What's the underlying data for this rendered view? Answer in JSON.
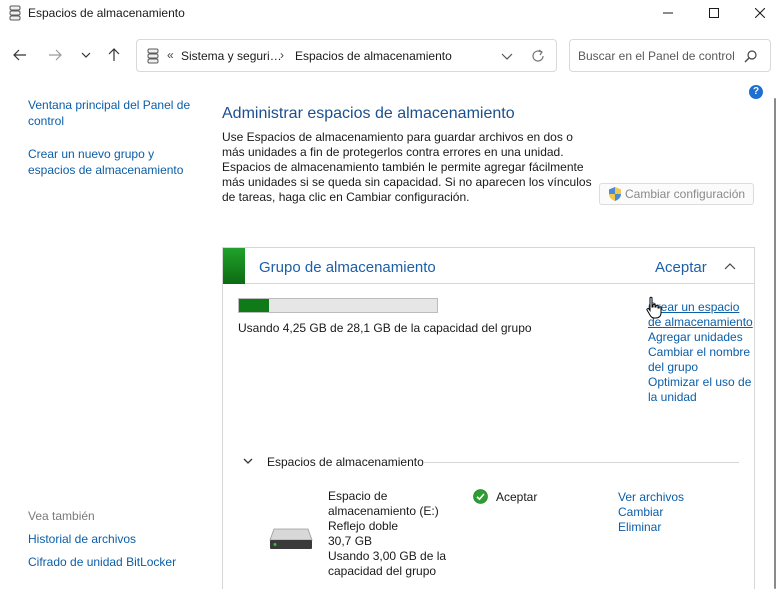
{
  "window": {
    "title": "Espacios de almacenamiento"
  },
  "nav": {
    "breadcrumb_prefix": "«",
    "crumbs": [
      "Sistema y seguri…",
      "Espacios de almacenamiento"
    ],
    "separator": "›",
    "search_placeholder": "Buscar en el Panel de control"
  },
  "sidebar": {
    "links": [
      "Ventana principal del Panel de control",
      "Crear un nuevo grupo y espacios de almacenamiento"
    ],
    "see_also_label": "Vea también",
    "see_also_links": [
      "Historial de archivos",
      "Cifrado de unidad BitLocker"
    ]
  },
  "help": {
    "label": "?"
  },
  "main": {
    "title": "Administrar espacios de almacenamiento",
    "description": "Use Espacios de almacenamiento para guardar archivos en dos o más unidades a fin de protegerlos contra errores en una unidad. Espacios de almacenamiento también le permite agregar fácilmente más unidades si se queda sin capacidad. Si no aparecen los vínculos de tareas, haga clic en Cambiar configuración.",
    "change_settings_label": "Cambiar configuración"
  },
  "pool": {
    "title": "Grupo de almacenamiento",
    "status": "Aceptar",
    "usage_fraction": 0.151,
    "usage_text": "Usando 4,25 GB de 28,1 GB de la capacidad del grupo",
    "links": [
      "Crear un espacio de almacenamiento",
      "Agregar unidades",
      "Cambiar el nombre del grupo",
      "Optimizar el uso de la unidad"
    ],
    "spaces_section_label": "Espacios de almacenamiento",
    "space": {
      "name": "Espacio de almacenamiento (E:)",
      "type": "Reflejo doble",
      "size": "30,7 GB",
      "usage": "Usando 3,00 GB de la capacidad del grupo",
      "status": "Aceptar",
      "links": [
        "Ver archivos",
        "Cambiar",
        "Eliminar"
      ]
    }
  },
  "colors": {
    "link": "#0b5ea8",
    "accent_green": "#0f7a18",
    "heading": "#1c4f8f"
  }
}
